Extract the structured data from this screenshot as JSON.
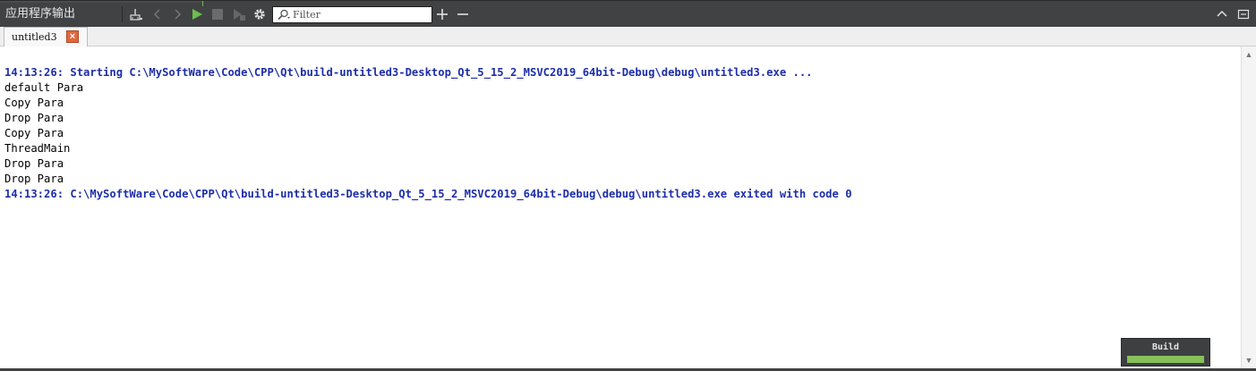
{
  "pane": {
    "title": "应用程序输出"
  },
  "filter": {
    "placeholder": "Filter",
    "value": ""
  },
  "tabs": [
    {
      "label": "untitled3",
      "close": "×"
    }
  ],
  "output": {
    "lines": [
      {
        "text": "14:13:26: Starting C:\\MySoftWare\\Code\\CPP\\Qt\\build-untitled3-Desktop_Qt_5_15_2_MSVC2019_64bit-Debug\\debug\\untitled3.exe ...",
        "kind": "sys"
      },
      {
        "text": "default Para",
        "kind": "std"
      },
      {
        "text": "Copy Para",
        "kind": "std"
      },
      {
        "text": "Drop Para",
        "kind": "std"
      },
      {
        "text": "Copy Para",
        "kind": "std"
      },
      {
        "text": "ThreadMain",
        "kind": "std"
      },
      {
        "text": "Drop Para",
        "kind": "std"
      },
      {
        "text": "Drop Para",
        "kind": "std"
      },
      {
        "text": "14:13:26: C:\\MySoftWare\\Code\\CPP\\Qt\\build-untitled3-Desktop_Qt_5_15_2_MSVC2019_64bit-Debug\\debug\\untitled3.exe exited with code 0",
        "kind": "sys"
      }
    ]
  },
  "build": {
    "label": "Build",
    "progress": 1.0
  },
  "colors": {
    "toolbar": "#404244",
    "system_text": "#1d2ea8",
    "build_fill": "#86c05a",
    "close_tab": "#e0683b",
    "run_green": "#6cbf4a"
  },
  "icons": [
    "clear-output-icon",
    "chevron-left-icon",
    "chevron-right-icon",
    "run-icon",
    "stop-icon",
    "attach-debugger-icon",
    "gear-icon",
    "search-icon",
    "plus-icon",
    "minus-icon",
    "chevron-up-icon",
    "restore-icon",
    "close-icon"
  ]
}
